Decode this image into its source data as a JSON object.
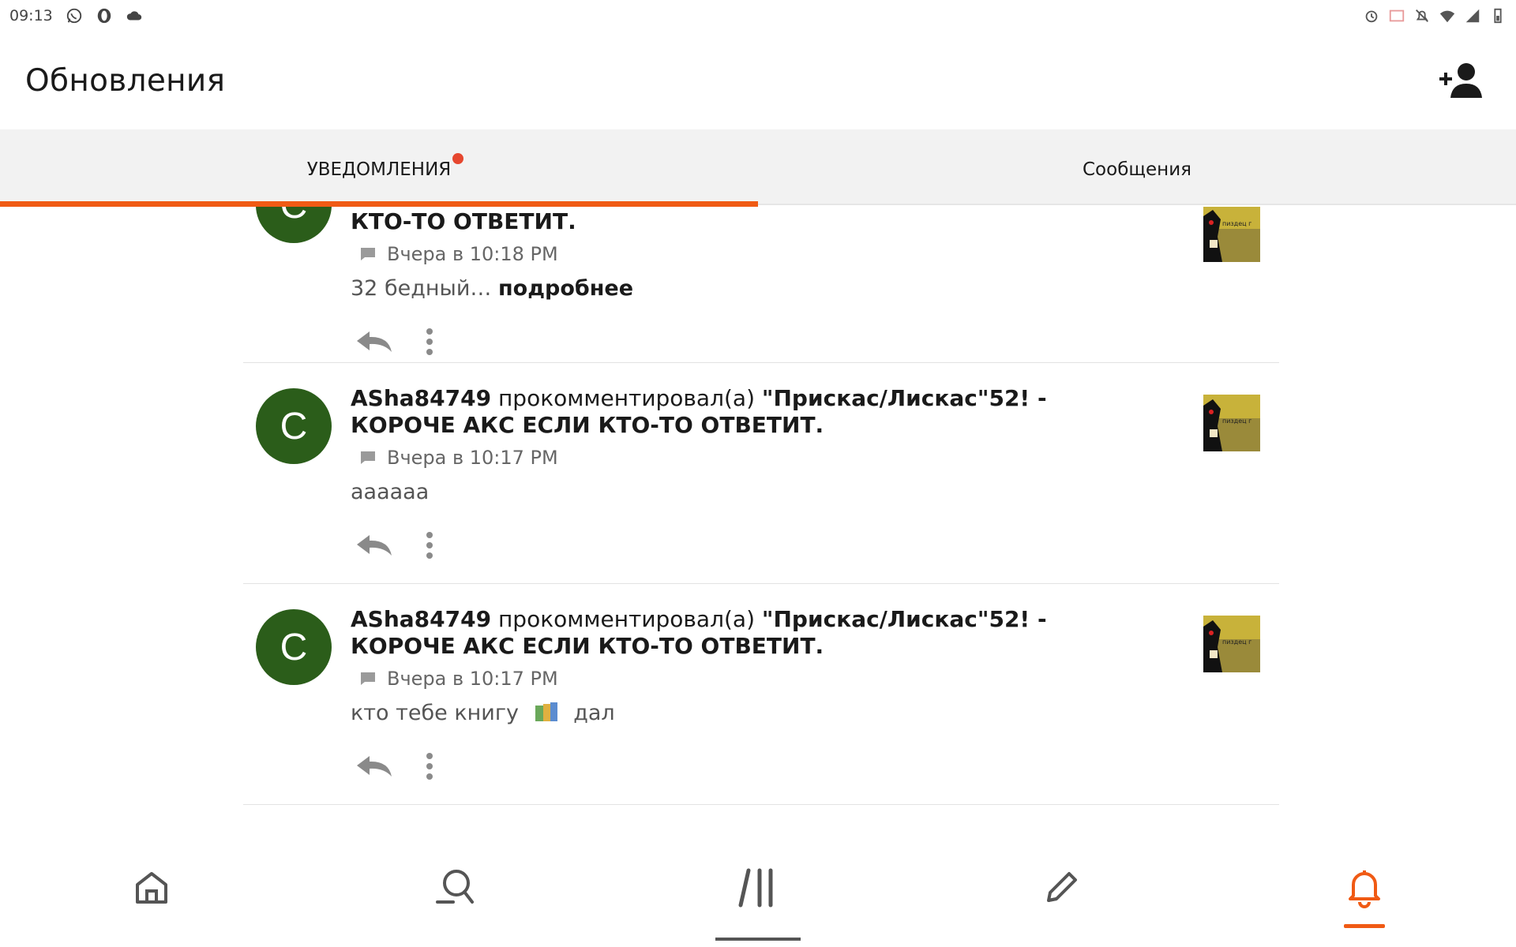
{
  "status_bar": {
    "time": "09:13",
    "left_icons": [
      "whatsapp-icon",
      "opera-icon",
      "cloud-icon"
    ],
    "right_icons": [
      "alarm-icon",
      "cast-icon",
      "mute-icon",
      "wifi-icon",
      "signal-icon",
      "battery-icon"
    ]
  },
  "app_bar": {
    "title": "Обновления",
    "action_icon": "add-friend-icon"
  },
  "tabs": [
    {
      "label": "УВЕДОМЛЕНИЯ",
      "active": true,
      "has_dot": true
    },
    {
      "label": "Сообщения",
      "active": false,
      "has_dot": false
    }
  ],
  "colors": {
    "accent": "#f05a14",
    "dot": "#e6472f",
    "avatar_bg": "#2b5d1a"
  },
  "notifications": [
    {
      "avatar_letter": "C",
      "author": "",
      "action": "",
      "topic_line2": "КТО-ТО ОТВЕТИТ.",
      "time": "Вчера в 10:18 PM",
      "text": "32 бедный…",
      "more_label": "подробнее"
    },
    {
      "avatar_letter": "C",
      "author": "ASha84749",
      "action": "прокомментировал(а)",
      "topic": "\"Прискас/Лискас\"52! - КОРОЧЕ АКС ЕСЛИ КТО-ТО ОТВЕТИТ.",
      "time": "Вчера в 10:17 PM",
      "text": "аааааа"
    },
    {
      "avatar_letter": "C",
      "author": "ASha84749",
      "action": "прокомментировал(а)",
      "topic": "\"Прискас/Лискас\"52! - КОРОЧЕ АКС ЕСЛИ КТО-ТО ОТВЕТИТ.",
      "time": "Вчера в 10:17 PM",
      "text_before": "кто тебе книгу",
      "text_after": "дал"
    }
  ],
  "thumbnail_caption": "пиздец г",
  "bottom_nav": [
    {
      "icon": "home-icon",
      "active": false
    },
    {
      "icon": "search-icon",
      "active": false
    },
    {
      "icon": "feed-icon",
      "active": false,
      "system_line": true
    },
    {
      "icon": "pencil-icon",
      "active": false
    },
    {
      "icon": "bell-icon",
      "active": true
    }
  ]
}
